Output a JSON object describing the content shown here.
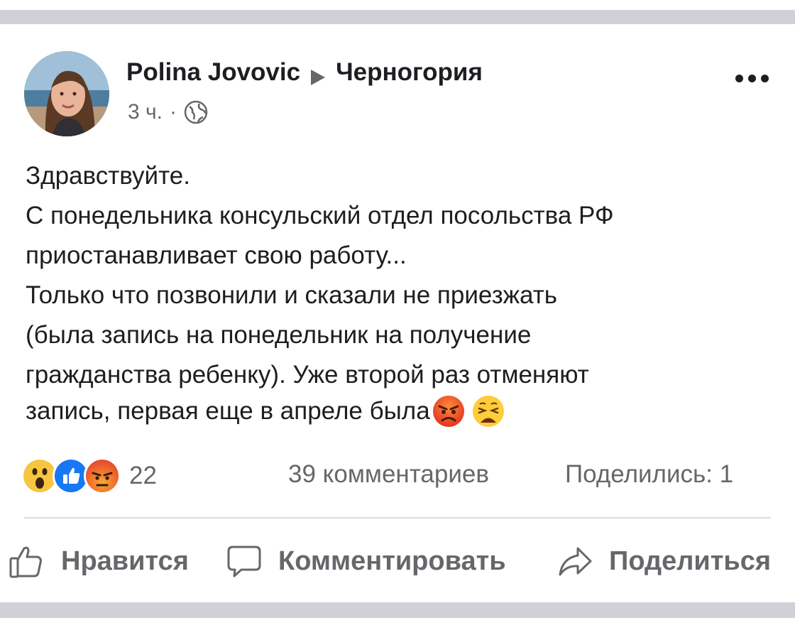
{
  "post": {
    "author": "Polina Jovovic",
    "target": "Черногория",
    "time": "3 ч.",
    "separator_dot": "·",
    "privacy_icon": "globe-icon",
    "body_lines": "Здравствуйте.\nС понедельника консульский отдел посольства РФ\nприостанавливает свою работу...\nТолько что позвонили и сказали не приезжать\n(была запись на понедельник на получение\nгражданства ребенку). Уже второй раз отменяют",
    "body_last_line": "запись, первая еще в апреле была",
    "body_emojis": [
      "angry-face-emoji",
      "weary-face-emoji"
    ]
  },
  "stats": {
    "reactions": [
      "wow-reaction-icon",
      "like-reaction-icon",
      "angry-reaction-icon"
    ],
    "reaction_count": "22",
    "comments": "39 комментариев",
    "shares": "Поделились: 1"
  },
  "actions": {
    "like_label": "Нравится",
    "comment_label": "Комментировать",
    "share_label": "Поделиться"
  },
  "colors": {
    "divider": "#cfd1d6",
    "secondary_text": "#65676b",
    "like_blue": "#1877f2",
    "angry_orange": "#f05d23"
  }
}
